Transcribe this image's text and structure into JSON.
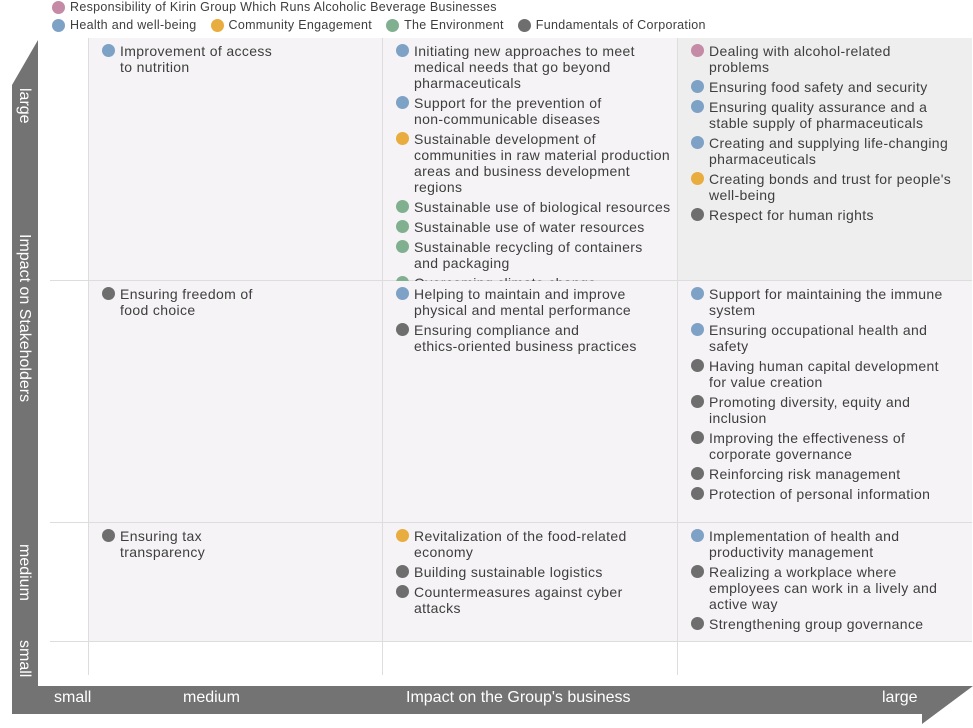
{
  "categories": [
    {
      "key": "alcohol",
      "label": "Responsibility of Kirin Group Which Runs Alcoholic Beverage Businesses",
      "color": "#c48aa6"
    },
    {
      "key": "health",
      "label": "Health and well-being",
      "color": "#7ea1c6"
    },
    {
      "key": "community",
      "label": "Community Engagement",
      "color": "#e9ac3e"
    },
    {
      "key": "environment",
      "label": "The Environment",
      "color": "#80b08f"
    },
    {
      "key": "fundamentals",
      "label": "Fundamentals of Corporation",
      "color": "#6e6e6e"
    }
  ],
  "colors": {
    "alcohol": "#c48aa6",
    "health": "#7ea1c6",
    "community": "#e9ac3e",
    "environment": "#80b08f",
    "fundamentals": "#6e6e6e",
    "axis": "#737373"
  },
  "y_axis": {
    "title": "Impact on Stakeholders",
    "large": "large",
    "medium": "medium",
    "small": "small"
  },
  "x_axis": {
    "title": "Impact on the Group's business",
    "small": "small",
    "medium": "medium",
    "large": "large"
  },
  "cells": {
    "large_medium": [
      {
        "cat": "health",
        "text": "Improvement of access\nto nutrition"
      }
    ],
    "large_large": [
      {
        "cat": "health",
        "text": "Initiating new approaches to meet\nmedical needs that go beyond\npharmaceuticals"
      },
      {
        "cat": "health",
        "text": "Support for the prevention of\nnon-communicable diseases"
      },
      {
        "cat": "community",
        "text": "Sustainable development of\ncommunities in raw material production\nareas and business development regions"
      },
      {
        "cat": "environment",
        "text": "Sustainable use of biological resources"
      },
      {
        "cat": "environment",
        "text": "Sustainable use of water resources"
      },
      {
        "cat": "environment",
        "text": "Sustainable recycling of containers\nand packaging"
      },
      {
        "cat": "environment",
        "text": "Overcoming climate change"
      }
    ],
    "large_xlarge": [
      {
        "cat": "alcohol",
        "text": "Dealing with alcohol-related\nproblems"
      },
      {
        "cat": "health",
        "text": "Ensuring food safety and security"
      },
      {
        "cat": "health",
        "text": "Ensuring quality assurance and a\nstable supply of pharmaceuticals"
      },
      {
        "cat": "health",
        "text": "Creating and supplying life-changing\npharmaceuticals"
      },
      {
        "cat": "community",
        "text": "Creating bonds and trust for people's\nwell-being"
      },
      {
        "cat": "fundamentals",
        "text": "Respect for human rights"
      }
    ],
    "mid_medium": [
      {
        "cat": "fundamentals",
        "text": "Ensuring freedom of\nfood choice"
      }
    ],
    "mid_large": [
      {
        "cat": "health",
        "text": "Helping to maintain and improve\nphysical and mental performance"
      },
      {
        "cat": "fundamentals",
        "text": "Ensuring compliance and\nethics-oriented business practices"
      }
    ],
    "mid_xlarge": [
      {
        "cat": "health",
        "text": "Support for maintaining the immune\nsystem"
      },
      {
        "cat": "health",
        "text": "Ensuring occupational health and\nsafety"
      },
      {
        "cat": "fundamentals",
        "text": "Having human capital development\nfor value creation"
      },
      {
        "cat": "fundamentals",
        "text": "Promoting diversity, equity and\ninclusion"
      },
      {
        "cat": "fundamentals",
        "text": "Improving the effectiveness of\ncorporate governance"
      },
      {
        "cat": "fundamentals",
        "text": "Reinforcing risk management"
      },
      {
        "cat": "fundamentals",
        "text": "Protection of personal information"
      }
    ],
    "med_medium": [
      {
        "cat": "fundamentals",
        "text": "Ensuring tax\ntransparency"
      }
    ],
    "med_large": [
      {
        "cat": "community",
        "text": "Revitalization of the food-related\neconomy"
      },
      {
        "cat": "fundamentals",
        "text": "Building sustainable logistics"
      },
      {
        "cat": "fundamentals",
        "text": "Countermeasures against cyber\nattacks"
      }
    ],
    "med_xlarge": [
      {
        "cat": "health",
        "text": "Implementation of health and\nproductivity management"
      },
      {
        "cat": "fundamentals",
        "text": "Realizing a workplace where\nemployees can work in a lively and\nactive way"
      },
      {
        "cat": "fundamentals",
        "text": "Strengthening group governance"
      }
    ]
  }
}
